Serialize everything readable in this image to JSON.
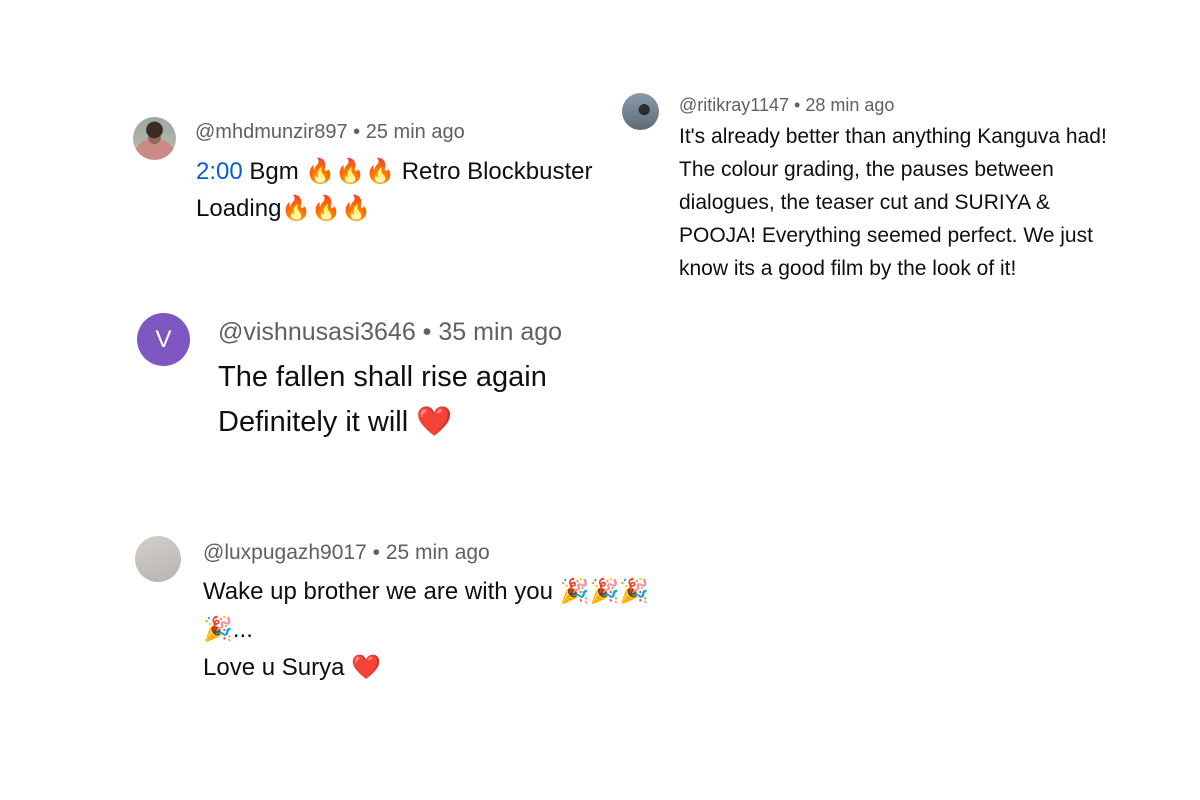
{
  "comments": [
    {
      "handle": "@mhdmunzir897",
      "time": "25 min ago",
      "timestamp_link": "2:00",
      "lines": [
        "Bgm 🔥🔥🔥 Retro Blockbuster",
        "Loading🔥🔥🔥"
      ]
    },
    {
      "handle": "@ritikray1147",
      "time": "28 min ago",
      "lines": [
        "It's already better than anything Kanguva had!",
        "The colour grading, the pauses between",
        "dialogues, the teaser cut and SURIYA &",
        "POOJA! Everything seemed perfect. We just",
        "know its a good film by the look of it!"
      ]
    },
    {
      "handle": "@vishnusasi3646",
      "time": "35 min ago",
      "avatar_letter": "V",
      "avatar_color": "#7e57c2",
      "lines": [
        "The fallen shall rise again",
        "Definitely it will ❤️"
      ]
    },
    {
      "handle": "@luxpugazh9017",
      "time": "25 min ago",
      "lines": [
        "Wake up brother we are with you 🎉🎉🎉",
        "🎉...",
        "Love u Surya ❤️"
      ]
    }
  ],
  "separator": "•"
}
